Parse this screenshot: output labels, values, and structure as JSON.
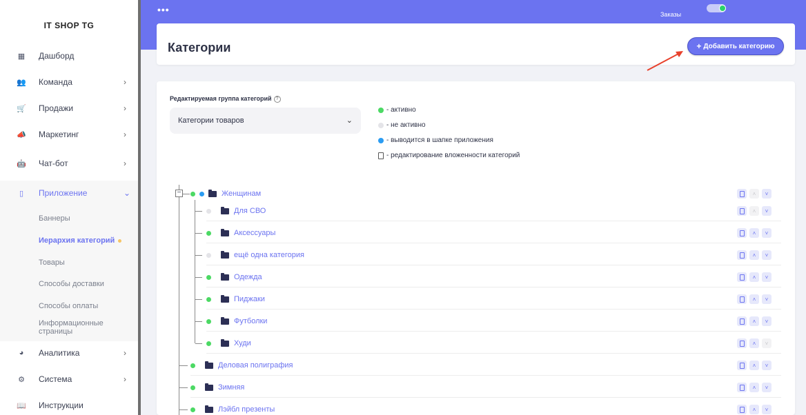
{
  "brand": "IT SHOP TG",
  "sidebar": {
    "items": [
      {
        "label": "Дашборд",
        "icon": "grid-icon",
        "chevron": ""
      },
      {
        "label": "Команда",
        "icon": "team-icon",
        "chevron": "›"
      },
      {
        "label": "Продажи",
        "icon": "cart-icon",
        "chevron": "›"
      },
      {
        "label": "Маркетинг",
        "icon": "megaphone-icon",
        "chevron": "›"
      },
      {
        "label": "Чат-бот",
        "icon": "robot-icon",
        "chevron": "›"
      },
      {
        "label": "Приложение",
        "icon": "mobile-icon",
        "chevron": "⌄"
      },
      {
        "label": "Аналитика",
        "icon": "pie-chart-icon",
        "chevron": "›"
      },
      {
        "label": "Система",
        "icon": "gears-icon",
        "chevron": "›"
      },
      {
        "label": "Инструкции",
        "icon": "book-icon",
        "chevron": ""
      }
    ],
    "subitems": [
      {
        "label": "Баннеры"
      },
      {
        "label": "Иерархия категорий"
      },
      {
        "label": "Товары"
      },
      {
        "label": "Способы доставки"
      },
      {
        "label": "Способы оплаты"
      },
      {
        "label": "Информационные страницы"
      }
    ]
  },
  "topbar": {
    "menu_dots": "•••",
    "orders_label": "Заказы"
  },
  "header": {
    "title": "Категории",
    "add_button_label": "Добавить категорию",
    "add_button_icon": "+"
  },
  "group": {
    "label": "Редактируемая группа категорий",
    "help_icon": "?",
    "selected": "Категории товаров"
  },
  "legend": [
    {
      "color": "#4cd964",
      "text": "- активно",
      "kind": "dot"
    },
    {
      "color": "#e4e4e8",
      "text": "- не активно",
      "kind": "dot"
    },
    {
      "color": "#2b9cf2",
      "text": "- выводится в шапке приложения",
      "kind": "dot"
    },
    {
      "color": "",
      "text": "- редактирование вложенности категорий",
      "kind": "doc"
    }
  ],
  "tree": {
    "root": {
      "label": "Женщинам",
      "toggle": "−"
    },
    "children": [
      {
        "label": "Для СВО",
        "active": false,
        "up_disabled": true
      },
      {
        "label": "Аксессуары",
        "active": true,
        "up_disabled": false
      },
      {
        "label": "ещё одна категория",
        "active": false,
        "up_disabled": false
      },
      {
        "label": "Одежда",
        "active": true,
        "up_disabled": false
      },
      {
        "label": "Пиджаки",
        "active": true,
        "up_disabled": false
      },
      {
        "label": "Футболки",
        "active": true,
        "up_disabled": false
      },
      {
        "label": "Худи",
        "active": true,
        "up_disabled": false,
        "down_disabled": true
      }
    ],
    "siblings": [
      {
        "label": "Деловая полиграфия"
      },
      {
        "label": "Зимняя"
      },
      {
        "label": "Лэйбл презенты"
      }
    ]
  },
  "controls": {
    "up": "˄",
    "down": "˅"
  },
  "colors": {
    "accent": "#6b73f0",
    "active": "#4cd964",
    "inactive": "#e4e4e8",
    "header": "#2b9cf2"
  }
}
